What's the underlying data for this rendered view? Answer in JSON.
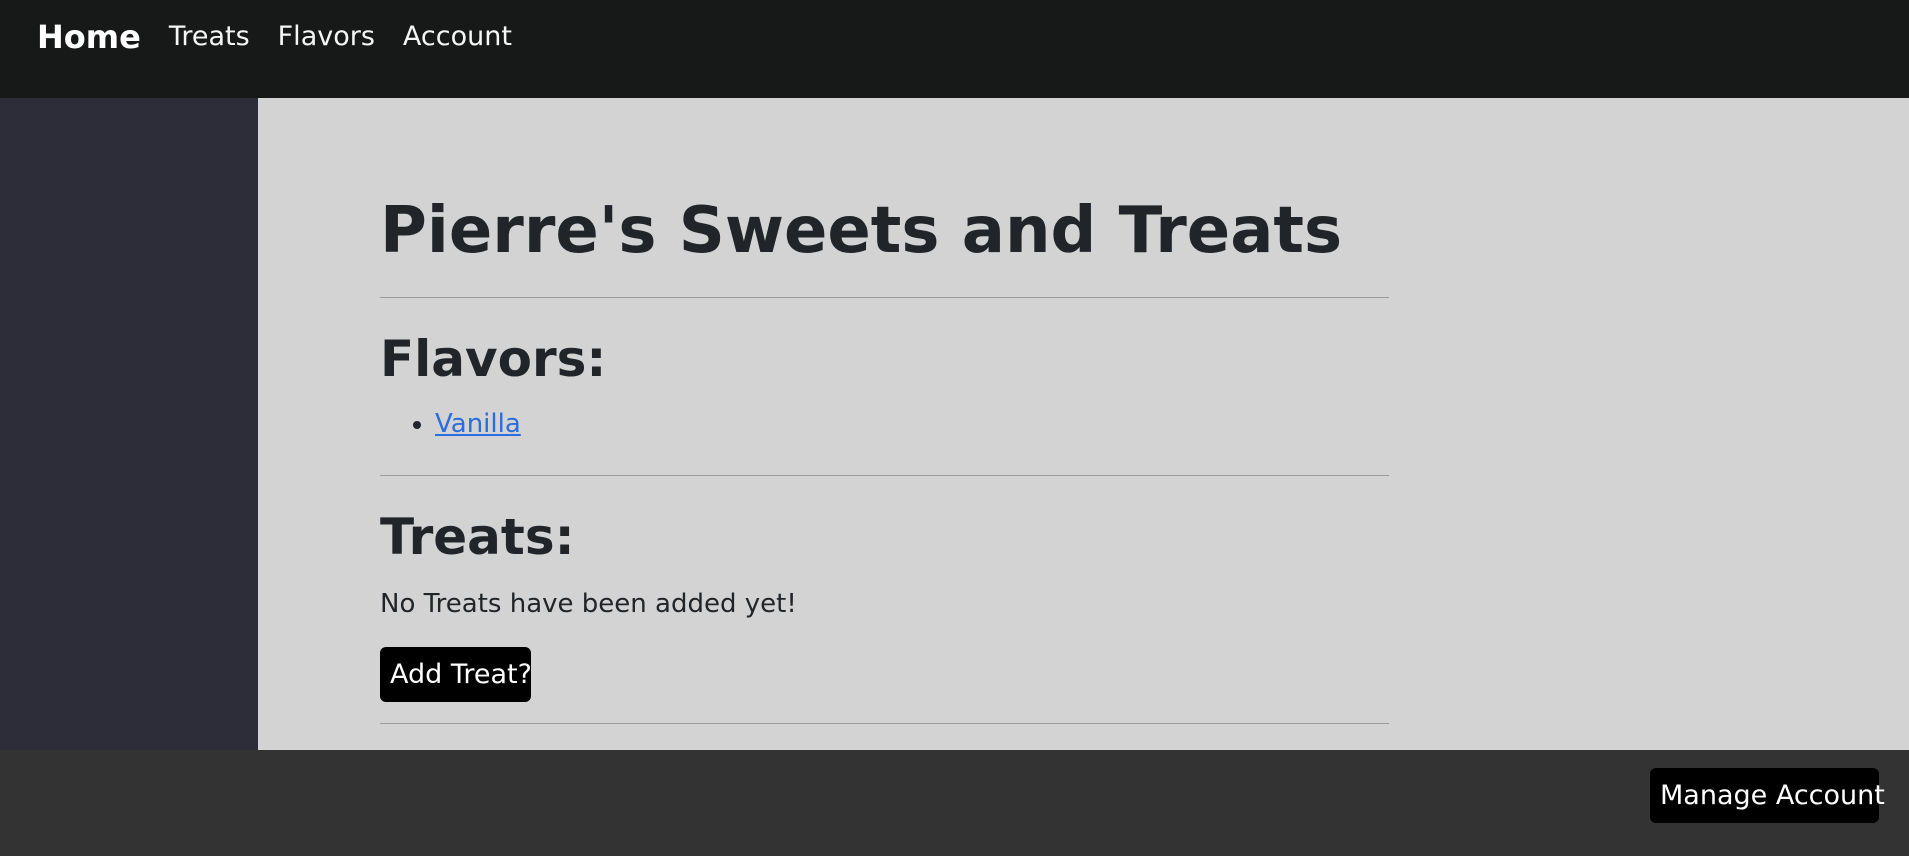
{
  "nav": {
    "brand": "Home",
    "links": [
      "Treats",
      "Flavors",
      "Account"
    ]
  },
  "main": {
    "title": "Pierre's Sweets and Treats",
    "flavors": {
      "heading": "Flavors:",
      "items": [
        "Vanilla"
      ]
    },
    "treats": {
      "heading": "Treats:",
      "empty_message": "No Treats have been added yet!",
      "add_button": "Add Treat?"
    }
  },
  "footer": {
    "manage_button": "Manage Account"
  },
  "colors": {
    "navbar": "#171919",
    "sidebar": "#2d2d3a",
    "main_bg": "#d3d3d3",
    "footer": "#333333",
    "link": "#2a6de0",
    "button": "#000000"
  }
}
